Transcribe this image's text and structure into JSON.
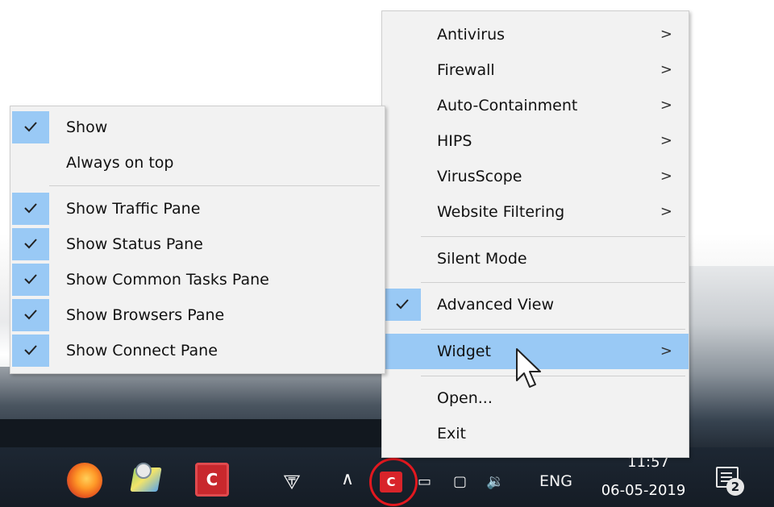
{
  "main_menu": {
    "items": [
      {
        "label": "Antivirus",
        "arrow": ">"
      },
      {
        "label": "Firewall",
        "arrow": ">"
      },
      {
        "label": "Auto-Containment",
        "arrow": ">"
      },
      {
        "label": "HIPS",
        "arrow": ">"
      },
      {
        "label": "VirusScope",
        "arrow": ">"
      },
      {
        "label": "Website Filtering",
        "arrow": ">"
      },
      {
        "label": "Silent Mode"
      },
      {
        "label": "Advanced View",
        "checked": true
      },
      {
        "label": "Widget",
        "arrow": ">",
        "highlighted": true
      },
      {
        "label": "Open..."
      },
      {
        "label": "Exit"
      }
    ]
  },
  "widget_submenu": {
    "items": [
      {
        "label": "Show",
        "checked": true
      },
      {
        "label": "Always on top",
        "checked": false
      },
      {
        "label": "Show Traffic Pane",
        "checked": true
      },
      {
        "label": "Show Status Pane",
        "checked": true
      },
      {
        "label": "Show Common Tasks Pane",
        "checked": true
      },
      {
        "label": "Show Browsers Pane",
        "checked": true
      },
      {
        "label": "Show Connect Pane",
        "checked": true
      }
    ]
  },
  "taskbar": {
    "apps": [
      {
        "icon": "firefox-icon"
      },
      {
        "icon": "maps-icon"
      },
      {
        "icon": "comodo-icon",
        "letter": "C"
      }
    ],
    "tray": {
      "people_icon": "people-icon",
      "show_hidden_icon": "chevron-up-icon",
      "comodo_tray_letter": "C",
      "battery_icon": "battery-icon",
      "network_icon": "network-icon",
      "volume_icon": "volume-icon",
      "language": "ENG",
      "time": "11:57",
      "date": "06-05-2019",
      "notification_count": "2"
    }
  },
  "colors": {
    "menu_bg": "#f2f2f2",
    "highlight": "#99c9f5",
    "taskbar_bg": "#151c25",
    "comodo_red": "#d8242a",
    "annotation_ring": "#e2181f"
  }
}
